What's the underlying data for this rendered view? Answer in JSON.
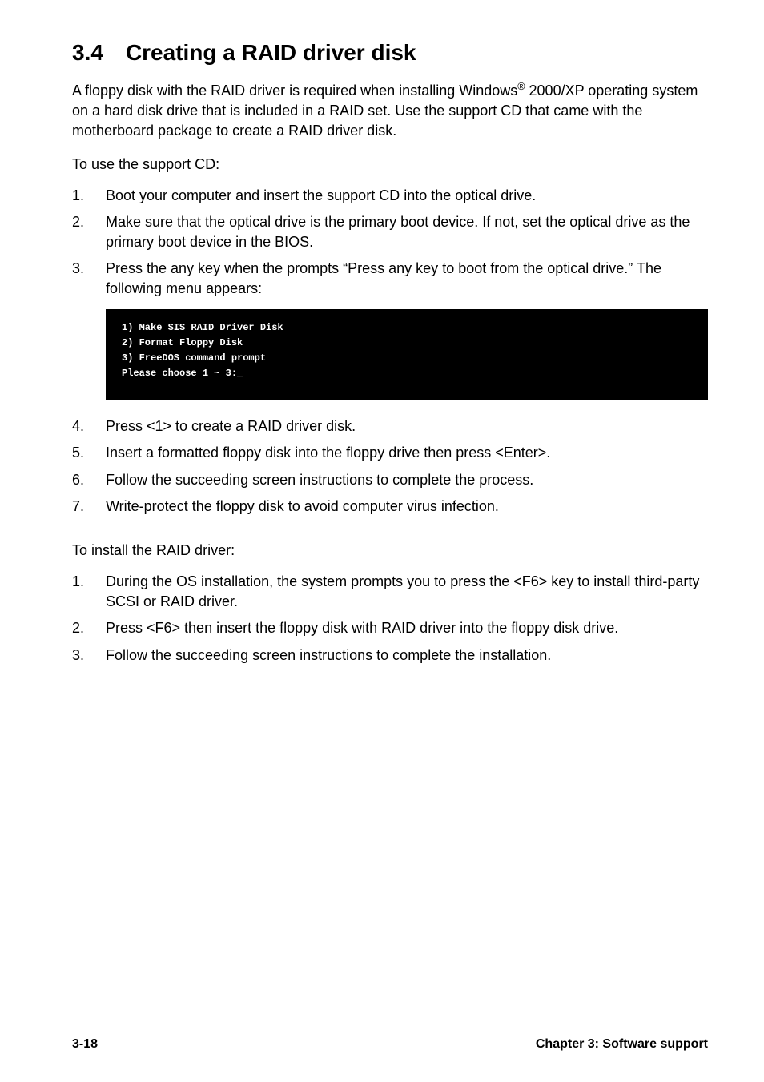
{
  "heading": {
    "number": "3.4",
    "title": "Creating a RAID driver disk"
  },
  "intro": {
    "pre": "A floppy disk with the RAID driver is required when installing Windows",
    "sup": "®",
    "post": " 2000/XP operating system on a hard disk drive that is included in a RAID set. Use the  support CD that came with the motherboard package to create a RAID driver disk."
  },
  "supportCDLabel": "To use the support CD:",
  "listA": [
    {
      "num": "1.",
      "text": "Boot your computer and insert the support CD into the optical drive."
    },
    {
      "num": "2.",
      "text": "Make sure that the optical drive is the primary boot device. If not, set the optical drive as the primary boot device in the BIOS."
    },
    {
      "num": "3.",
      "text": "Press the any key when the prompts “Press any key to boot from the optical drive.” The following menu appears:"
    }
  ],
  "codeLines": [
    "1) Make SIS RAID Driver Disk",
    "2) Format Floppy Disk",
    "3) FreeDOS command prompt",
    "Please choose 1 ~ 3:_"
  ],
  "listB": [
    {
      "num": "4.",
      "text": "Press <1> to create a RAID driver disk."
    },
    {
      "num": "5.",
      "text": "Insert a formatted floppy disk into the floppy drive then press <Enter>."
    },
    {
      "num": "6.",
      "text": "Follow the succeeding screen instructions to complete the process."
    },
    {
      "num": "7.",
      "text": "Write-protect the floppy disk to avoid computer virus infection."
    }
  ],
  "installLabel": "To install the RAID driver:",
  "listC": [
    {
      "num": "1.",
      "text": "During the OS installation, the system prompts you to press the <F6> key to install third-party SCSI or RAID driver."
    },
    {
      "num": "2.",
      "text": "Press <F6> then insert the floppy disk with RAID driver into the floppy disk drive."
    },
    {
      "num": "3.",
      "text": "Follow the succeeding screen instructions to complete the installation."
    }
  ],
  "footer": {
    "left": "3-18",
    "right": "Chapter 3: Software support"
  }
}
